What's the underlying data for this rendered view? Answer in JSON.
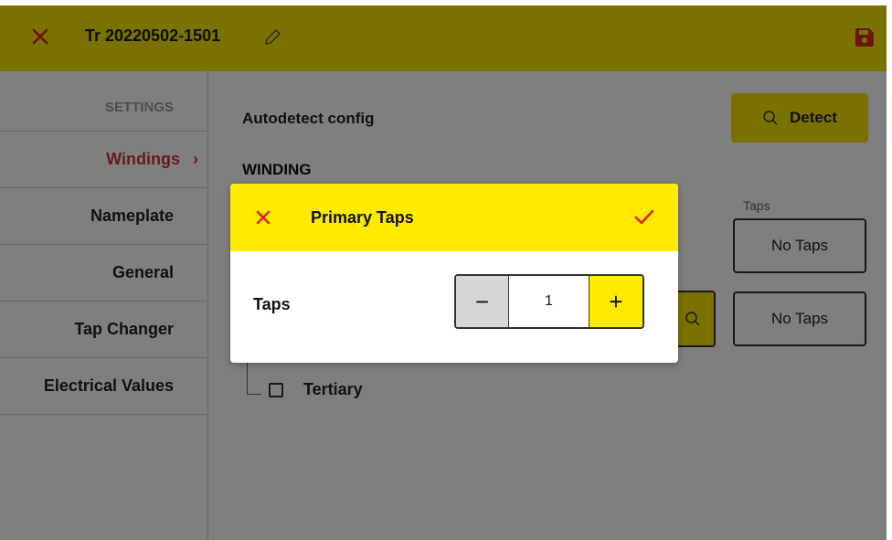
{
  "header": {
    "title": "Tr 20220502-1501",
    "close_icon": "close-icon",
    "edit_icon": "pencil-icon",
    "save_icon": "save-icon"
  },
  "sidebar": {
    "items": [
      {
        "label": "SETTINGS"
      },
      {
        "label": "Windings",
        "active": true
      },
      {
        "label": "Nameplate"
      },
      {
        "label": "General"
      },
      {
        "label": "Tap Changer"
      },
      {
        "label": "Electrical Values"
      }
    ]
  },
  "main": {
    "autodetect_label": "Autodetect config",
    "detect_button": "Detect",
    "winding_heading": "WINDING",
    "taps_column_label": "Taps",
    "taps_values": [
      "No Taps",
      "No Taps"
    ],
    "tertiary_label": "Tertiary"
  },
  "modal": {
    "title": "Primary Taps",
    "field_label": "Taps",
    "stepper_value": "1",
    "minus_label": "−",
    "plus_label": "+"
  },
  "colors": {
    "accent_yellow": "#f7e301",
    "modal_yellow": "#ffea00",
    "accent_red": "#d8281e",
    "active_nav": "#c8373a"
  }
}
